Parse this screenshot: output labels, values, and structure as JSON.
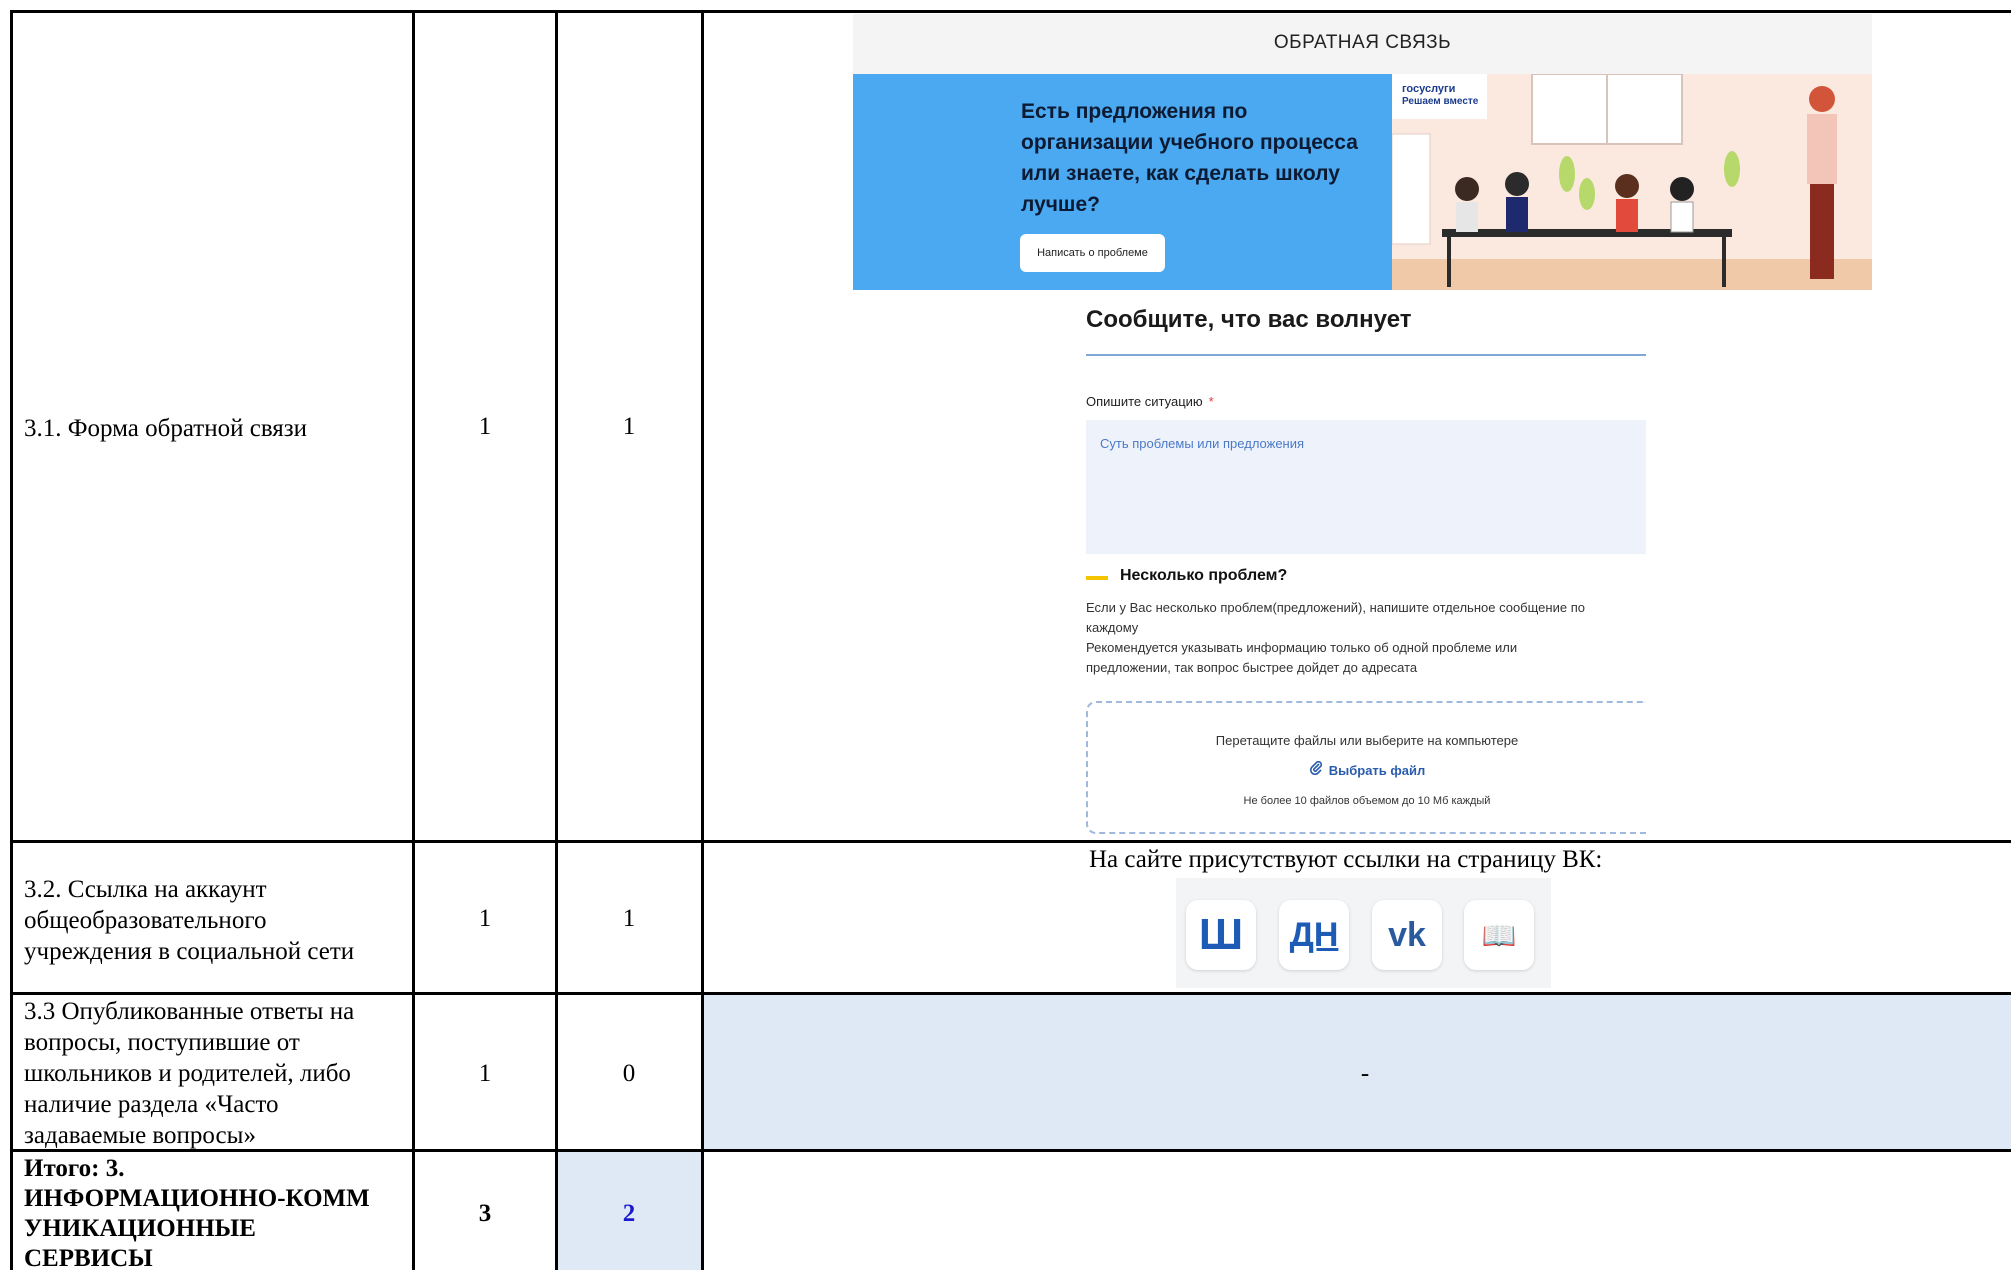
{
  "rows": [
    {
      "criterion": "3.1. Форма обратной связи",
      "max": "1",
      "score": "1"
    },
    {
      "criterion_lines": [
        "3.2. Ссылка на аккаунт",
        "общеобразовательного",
        "учреждения в социальной сети"
      ],
      "max": "1",
      "score": "1",
      "note": "На сайте присутствуют ссылки на страницу ВК:"
    },
    {
      "criterion_lines": [
        "3.3 Опубликованные ответы на",
        "вопросы, поступившие от",
        "школьников и родителей, либо",
        "наличие раздела «Часто",
        "задаваемые вопросы»"
      ],
      "max": "1",
      "score": "0",
      "note": "-"
    },
    {
      "criterion_lines": [
        "Итого: 3.",
        "ИНФОРМАЦИОННО-КОММ",
        "УНИКАЦИОННЫЕ",
        "СЕРВИСЫ"
      ],
      "max": "3",
      "score": "2"
    }
  ],
  "screenshot": {
    "header": "ОБРАТНАЯ СВЯЗЬ",
    "banner_lines": [
      "Есть предложения по",
      "организации учебного процесса",
      "или знаете, как сделать школу",
      "лучше?"
    ],
    "banner_button": "Написать о проблеме",
    "brand_top": "госуслуги",
    "brand_bottom": "Решаем вместе",
    "form_title": "Сообщите, что вас волнует",
    "field_label": "Опишите ситуацию",
    "required_mark": "*",
    "field_placeholder": "Суть проблемы или предложения",
    "many_title": "Несколько проблем?",
    "many_lines": [
      "Если у Вас несколько проблем(предложений), напишите отдельное сообщение по",
      "каждому",
      "Рекомендуется указывать информацию только об одной проблеме или",
      "предложении, так вопрос быстрее дойдет до адресата"
    ],
    "upload_hint": "Перетащите файлы или выберите на компьютере",
    "upload_button": "Выбрать файл",
    "upload_limit": "Не более 10 файлов объемом до 10 Мб каждый"
  },
  "social_icons": [
    {
      "icon": "school-sh-icon",
      "glyph": "Ш"
    },
    {
      "icon": "dnevnik-icon",
      "glyph": "ДН"
    },
    {
      "icon": "vk-icon",
      "glyph": "vk"
    },
    {
      "icon": "book-icon",
      "glyph": "📖"
    }
  ],
  "colors": {
    "shade": "#dfe9f5",
    "banner_blue": "#4aa9f0",
    "total_score": "#1a1acc"
  }
}
